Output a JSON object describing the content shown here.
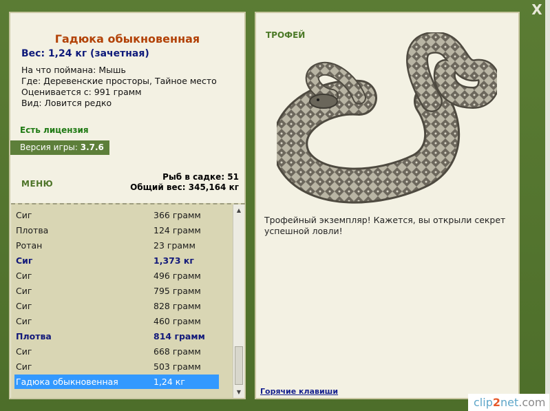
{
  "window": {
    "close_label": "X"
  },
  "left": {
    "title": "Гадюка обыкновенная",
    "weight_line": "Вес: 1,24 кг (зачетная)",
    "info": [
      "На что поймана: Мышь",
      "Где: Деревенские просторы, Тайное место",
      "Оценивается с: 991 грамм",
      "Вид: Ловится редко"
    ],
    "license": "Есть лицензия",
    "version_label": "Версия игры:",
    "version_value": "3.7.6",
    "menu_label": "МЕНЮ",
    "stats": {
      "in_cage": "Рыб в садке: 51",
      "total_weight": "Общий вес: 345,164 кг"
    },
    "catches": [
      {
        "name": "Сиг",
        "weight": "366 грамм",
        "bold": false
      },
      {
        "name": "Плотва",
        "weight": "124 грамм",
        "bold": false
      },
      {
        "name": "Ротан",
        "weight": "23 грамм",
        "bold": false
      },
      {
        "name": "Сиг",
        "weight": "1,373 кг",
        "bold": true
      },
      {
        "name": "Сиг",
        "weight": "496 грамм",
        "bold": false
      },
      {
        "name": "Сиг",
        "weight": "795 грамм",
        "bold": false
      },
      {
        "name": "Сиг",
        "weight": "828 грамм",
        "bold": false
      },
      {
        "name": "Сиг",
        "weight": "460 грамм",
        "bold": false
      },
      {
        "name": "Плотва",
        "weight": "814 грамм",
        "bold": true
      },
      {
        "name": "Сиг",
        "weight": "668 грамм",
        "bold": false
      },
      {
        "name": "Сиг",
        "weight": "503 грамм",
        "bold": false
      },
      {
        "name": "Гадюка обыкновенная",
        "weight": "1,24 кг",
        "bold": false,
        "selected": true
      }
    ]
  },
  "right": {
    "trophy_label": "ТРОФЕЙ",
    "trophy_text": "Трофейный экземпляр! Кажется, вы открыли секрет успешной ловли!",
    "hotkeys": "Горячие клавиши",
    "image_icon": "snake-image"
  },
  "brand": {
    "a": "clip",
    "b": "2",
    "c": "net",
    "d": ".com"
  }
}
